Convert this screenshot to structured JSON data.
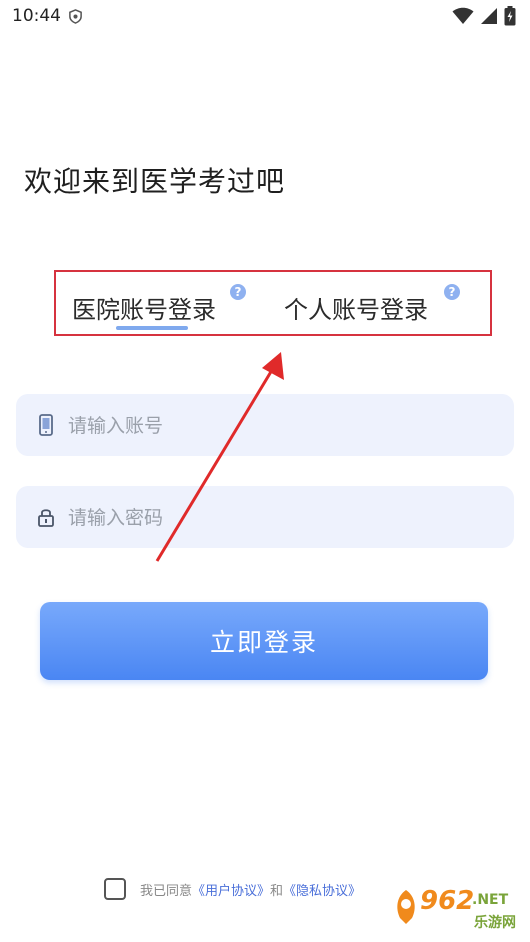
{
  "status_bar": {
    "time": "10:44",
    "icons": [
      "shield-icon",
      "wifi-icon",
      "signal-icon",
      "battery-icon"
    ]
  },
  "welcome": "欢迎来到医学考过吧",
  "tabs": {
    "hospital": "医院账号登录",
    "personal": "个人账号登录",
    "help_glyph": "?"
  },
  "form": {
    "account_placeholder": "请输入账号",
    "password_placeholder": "请输入密码"
  },
  "login_button": "立即登录",
  "agreement": {
    "prefix": "我已同意",
    "user_link": "《用户协议》",
    "and": "和",
    "privacy_link": "《隐私协议》"
  },
  "watermark": {
    "number": "962",
    "suffix": ".NET",
    "cn": "乐游网"
  },
  "colors": {
    "accent": "#4a86f3",
    "highlight_box": "#d6323f",
    "arrow": "#e02a2a",
    "field_bg": "#eef2fd"
  }
}
